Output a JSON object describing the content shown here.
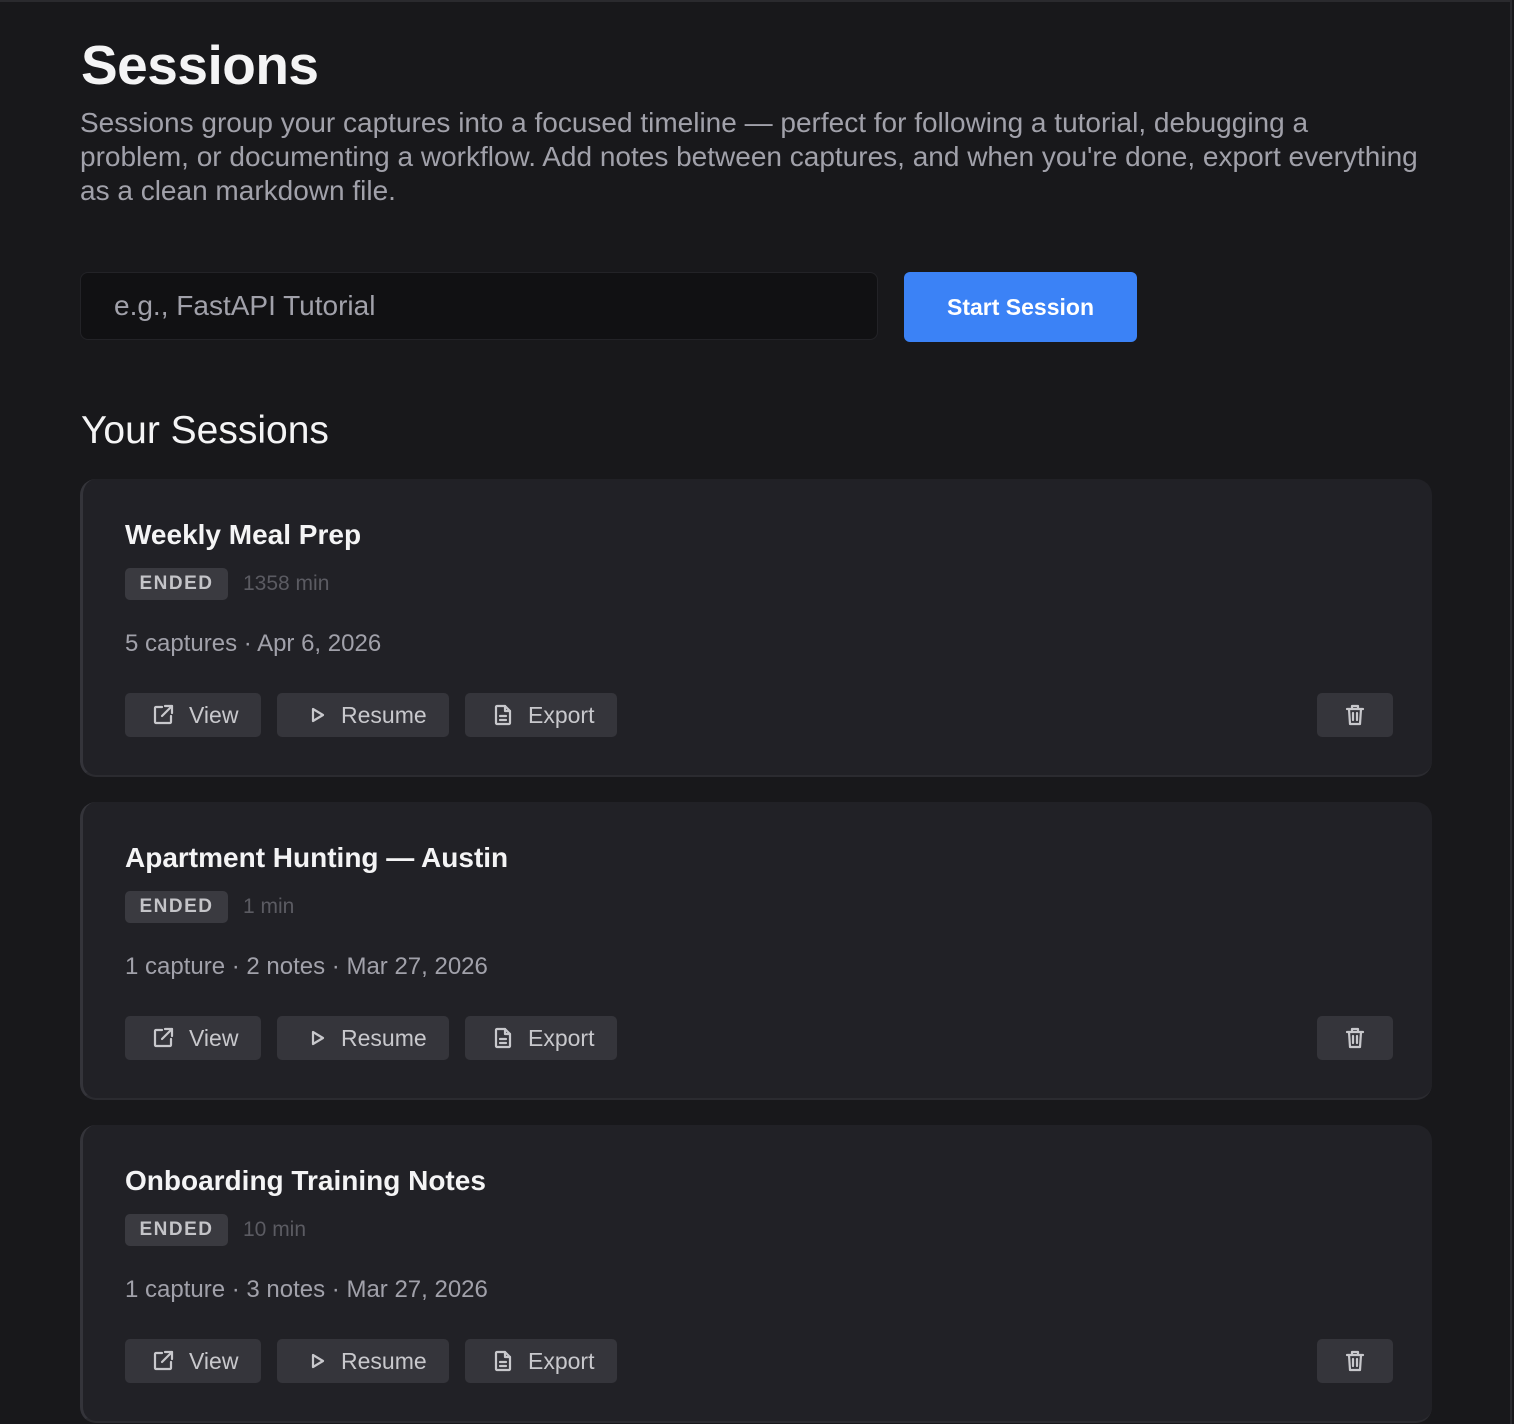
{
  "header": {
    "title": "Sessions",
    "description": "Sessions group your captures into a focused timeline — perfect for following a tutorial, debugging a problem, or documenting a workflow. Add notes between captures, and when you're done, export everything as a clean markdown file."
  },
  "new_session": {
    "placeholder": "e.g., FastAPI Tutorial",
    "value": "",
    "button_label": "Start Session"
  },
  "sessions_section": {
    "title": "Your Sessions"
  },
  "colors": {
    "accent": "#3b82f6",
    "background": "#18181b",
    "card": "#212126"
  },
  "icons": {
    "view": "external-link-icon",
    "resume": "play-icon",
    "export": "document-icon",
    "delete": "trash-icon"
  },
  "sessions": [
    {
      "title": "Weekly Meal Prep",
      "status": "ENDED",
      "duration": "1358 min",
      "meta": "5 captures · Apr 6, 2026",
      "view_label": "View",
      "resume_label": "Resume",
      "export_label": "Export"
    },
    {
      "title": "Apartment Hunting — Austin",
      "status": "ENDED",
      "duration": "1 min",
      "meta": "1 capture · 2 notes · Mar 27, 2026",
      "view_label": "View",
      "resume_label": "Resume",
      "export_label": "Export"
    },
    {
      "title": "Onboarding Training Notes",
      "status": "ENDED",
      "duration": "10 min",
      "meta": "1 capture · 3 notes · Mar 27, 2026",
      "view_label": "View",
      "resume_label": "Resume",
      "export_label": "Export"
    }
  ]
}
